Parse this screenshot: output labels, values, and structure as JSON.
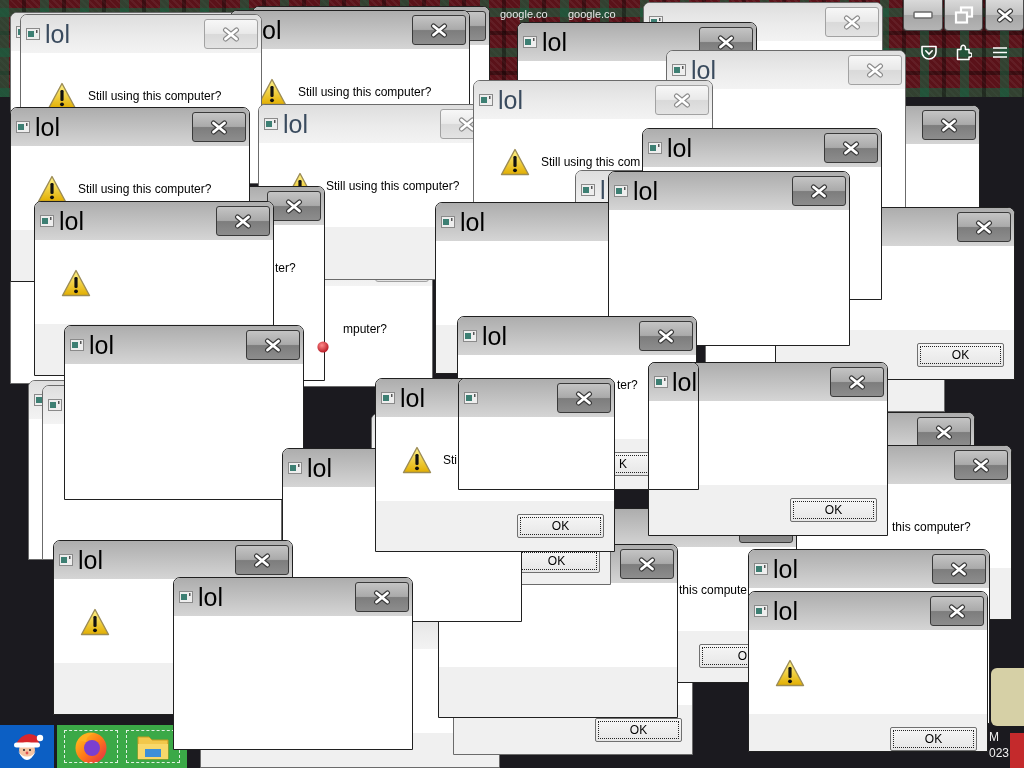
{
  "browser": {
    "tabs": [
      "google.co",
      "google.co"
    ]
  },
  "windows": [
    {
      "active": false
    },
    {
      "title": "lol",
      "active": false,
      "warning": true,
      "message": "Still using this computer?"
    },
    {
      "title": "ol",
      "active": true,
      "warning": true,
      "message": "Still using this computer?"
    },
    {
      "active": true
    },
    {
      "title": "lol",
      "active": true
    },
    {
      "active": false
    },
    {
      "title": "lol",
      "active": true,
      "warning": true,
      "message": "Still using this computer?",
      "footer": true
    },
    {
      "title": "lol",
      "active": false,
      "warning": true,
      "message": "Still using this computer?",
      "footer": true
    },
    {
      "title": "lol",
      "active": false,
      "warning": true,
      "message": "Still using this com"
    },
    {
      "title": "l"
    },
    {
      "title": "lol",
      "active": true
    },
    {
      "title": "lol",
      "active": false
    },
    {
      "active": true
    },
    {
      "title": "lol",
      "active": true,
      "warning": true,
      "footer": true
    },
    {
      "active": true,
      "message": "ter?"
    },
    {
      "message": "mputer?"
    },
    {
      "title": "lol",
      "active": true,
      "footer": true
    },
    {
      "title": "lol",
      "active": true
    },
    {
      "active": true,
      "footer": true,
      "ok": "OK"
    },
    {
      "active": false
    },
    {
      "active": false
    },
    {
      "title": "lol",
      "active": true
    },
    {
      "title": "lol",
      "active": true
    },
    {
      "title": "lol",
      "active": true,
      "warning": true,
      "message": "Sti",
      "footer": true,
      "ok": "OK"
    },
    {
      "title": "lol",
      "active": true,
      "message": "ter?",
      "footer": true,
      "ok": "K"
    },
    {
      "active": true
    },
    {
      "title": "lol",
      "active": true
    },
    {
      "active": true,
      "footer": true,
      "ok": "OK"
    },
    {
      "footer": true
    },
    {
      "active": true
    },
    {
      "active": true,
      "message": "this computer?",
      "footer": true
    },
    {
      "title": "lol",
      "active": true,
      "warning": true,
      "footer": true
    },
    {
      "footer": true,
      "ok": "OK"
    },
    {
      "title": "lol",
      "active": true
    },
    {
      "footer": true
    },
    {
      "active": true,
      "footer": true
    },
    {
      "active": true,
      "message": "this compute",
      "footer": true,
      "ok": "O"
    },
    {
      "title": "lol",
      "active": true
    },
    {
      "footer": true,
      "ok": "OK"
    },
    {
      "title": "lol",
      "active": true,
      "warning": true,
      "footer": true,
      "ok": "OK"
    }
  ],
  "taskbar": {
    "clock": {
      "time": "M",
      "date": "023"
    }
  }
}
